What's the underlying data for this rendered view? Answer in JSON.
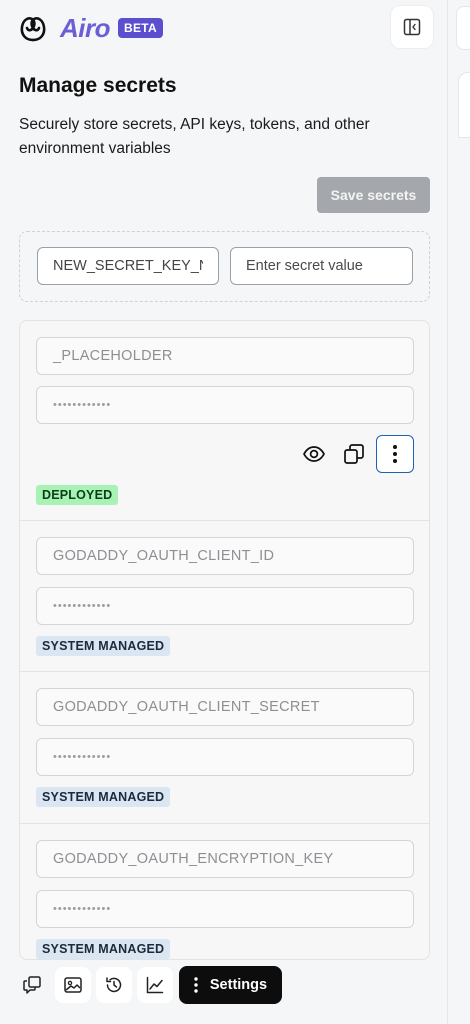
{
  "brand": {
    "name": "Airo",
    "badge": "BETA"
  },
  "page": {
    "title": "Manage secrets",
    "subtitle": "Securely store secrets, API keys, tokens, and other environment variables"
  },
  "actions": {
    "save_label": "Save secrets"
  },
  "new_secret": {
    "key_value": "NEW_SECRET_KEY_N",
    "value_placeholder": "Enter secret value"
  },
  "secrets": [
    {
      "name": "_PLACEHOLDER",
      "masked": "••••••••••••",
      "status": "DEPLOYED"
    },
    {
      "name": "GODADDY_OAUTH_CLIENT_ID",
      "masked": "••••••••••••",
      "status": "SYSTEM MANAGED"
    },
    {
      "name": "GODADDY_OAUTH_CLIENT_SECRET",
      "masked": "••••••••••••",
      "status": "SYSTEM MANAGED"
    },
    {
      "name": "GODADDY_OAUTH_ENCRYPTION_KEY",
      "masked": "••••••••••••",
      "status": "SYSTEM MANAGED"
    }
  ],
  "secret_row_icons": [
    "eye-icon",
    "copy-icon",
    "more-vertical-icon"
  ],
  "toolbar": {
    "icons": [
      "chat-copy-icon",
      "image-icon",
      "history-icon",
      "analytics-icon"
    ],
    "settings_label": "Settings"
  },
  "colors": {
    "brand": "#6b5fd6",
    "beta_bg": "#5b4fcf",
    "deployed_bg": "#a9f2b5",
    "system_bg": "#dbe6f3",
    "save_disabled": "#a4a7ab",
    "focus_border": "#1e5fb8"
  }
}
